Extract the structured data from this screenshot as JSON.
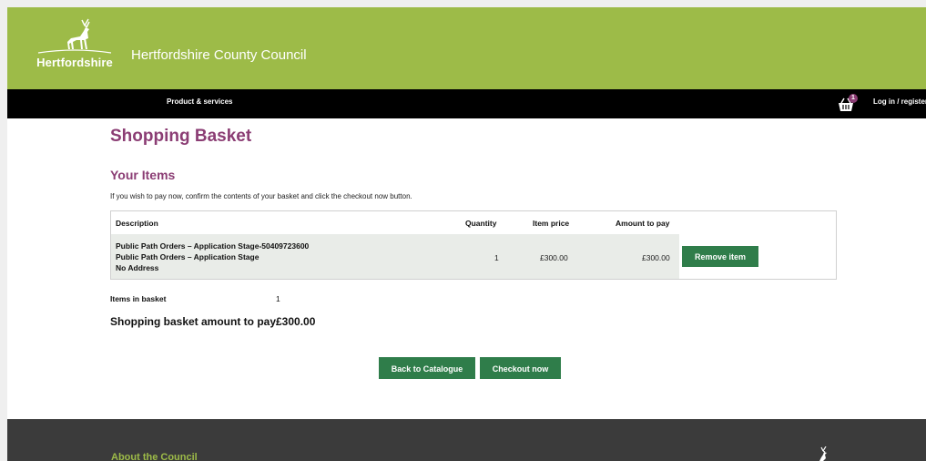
{
  "header": {
    "logo_text": "Hertfordshire",
    "council_name": "Hertfordshire County Council"
  },
  "nav": {
    "products": "Product & services",
    "basket_count": "1",
    "login": "Log in / register"
  },
  "page": {
    "title": "Shopping Basket",
    "section_title": "Your Items",
    "intro": "If you wish to pay now, confirm the contents of your basket and click the checkout now button."
  },
  "table": {
    "headers": {
      "description": "Description",
      "quantity": "Quantity",
      "item_price": "Item price",
      "amount": "Amount to pay"
    },
    "rows": [
      {
        "line1": "Public Path Orders – Application Stage-50409723600",
        "line2": "Public Path Orders – Application Stage",
        "line3": "No Address",
        "quantity": "1",
        "item_price": "£300.00",
        "amount": "£300.00",
        "remove_label": "Remove item"
      }
    ]
  },
  "summary": {
    "items_label": "Items in basket",
    "items_count": "1",
    "total_label": "Shopping basket amount to pay",
    "total_value": "£300.00"
  },
  "actions": {
    "back": "Back to Catalogue",
    "checkout": "Checkout now"
  },
  "footer": {
    "heading": "About the Council"
  },
  "icons": {
    "logo": "stag-icon",
    "basket": "basket-icon",
    "footer": "stag-icon"
  },
  "colors": {
    "brand_green": "#9dbb48",
    "heading_purple": "#8b3d74",
    "button_green": "#2f7d4a",
    "footer_bg": "#3b3b3b"
  }
}
